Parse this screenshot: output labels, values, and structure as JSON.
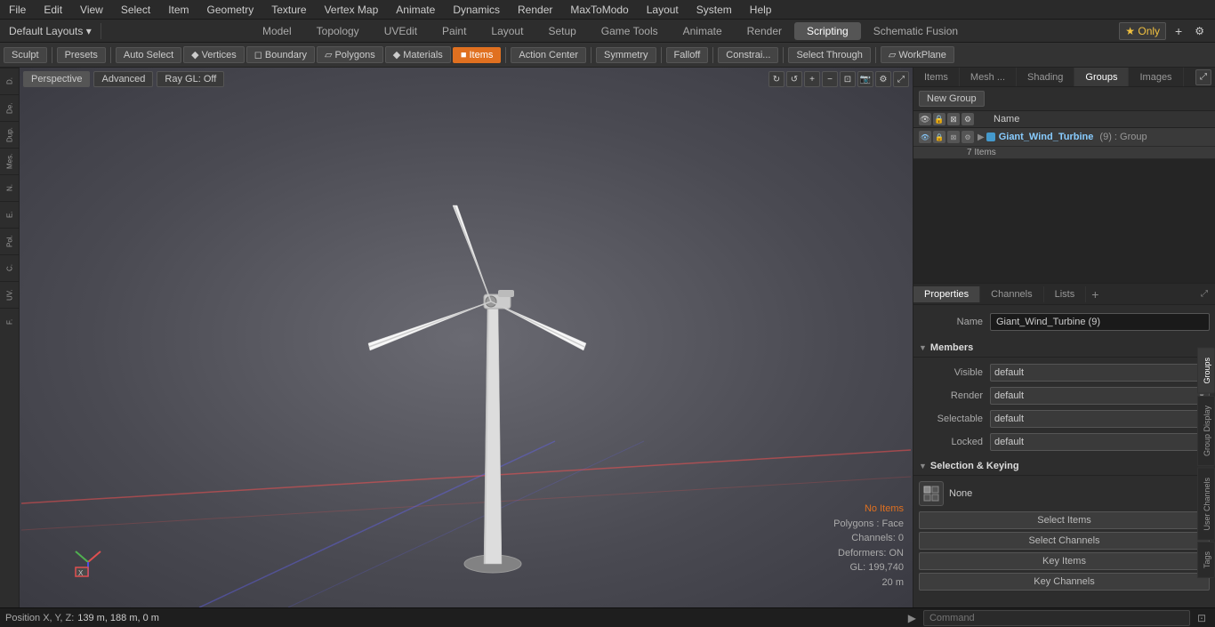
{
  "menu": {
    "items": [
      "File",
      "Edit",
      "View",
      "Select",
      "Item",
      "Geometry",
      "Texture",
      "Vertex Map",
      "Animate",
      "Dynamics",
      "Render",
      "MaxToModo",
      "Layout",
      "System",
      "Help"
    ]
  },
  "layout_bar": {
    "layout_label": "Default Layouts ▾",
    "tabs": [
      "Model",
      "Topology",
      "UVEdit",
      "Paint",
      "Layout",
      "Setup",
      "Game Tools",
      "Animate",
      "Render",
      "Scripting",
      "Schematic Fusion"
    ],
    "active_tab": "Render",
    "only_label": "★ Only",
    "plus_label": "+"
  },
  "toolbar": {
    "sculpt_label": "Sculpt",
    "presets_label": "Presets",
    "auto_select_label": "Auto Select",
    "vertices_label": "Vertices",
    "boundary_label": "Boundary",
    "polygons_label": "Polygons",
    "materials_label": "Materials",
    "items_label": "Items",
    "action_center_label": "Action Center",
    "symmetry_label": "Symmetry",
    "falloff_label": "Falloff",
    "constrain_label": "Constrai...",
    "select_through_label": "Select Through",
    "workplane_label": "WorkPlane"
  },
  "viewport": {
    "mode_label": "Perspective",
    "advanced_label": "Advanced",
    "ray_gl_label": "Ray GL: Off",
    "no_items_label": "No Items",
    "polygons_label": "Polygons : Face",
    "channels_label": "Channels: 0",
    "deformers_label": "Deformers: ON",
    "gl_label": "GL: 199,740",
    "zoom_label": "20 m",
    "position_label": "Position X, Y, Z:",
    "position_value": "139 m, 188 m, 0 m"
  },
  "right_panel": {
    "tabs": [
      "Items",
      "Mesh ...",
      "Shading",
      "Groups",
      "Images"
    ],
    "active_tab": "Groups",
    "expand_btn": "⊞",
    "new_group_label": "New Group",
    "header_icons": [
      "👁",
      "🔒",
      "⊠",
      "⚙"
    ],
    "name_header": "Name",
    "group": {
      "name": "Giant_Wind_Turbine",
      "suffix": "(9) : Group",
      "count": "7 Items",
      "icon_labels": [
        "eye",
        "lock",
        "box",
        "gear"
      ]
    }
  },
  "properties": {
    "tabs": [
      "Properties",
      "Channels",
      "Lists"
    ],
    "active_tab": "Properties",
    "name_label": "Name",
    "name_value": "Giant_Wind_Turbine (9)",
    "members_section": "Members",
    "visible_label": "Visible",
    "visible_value": "default",
    "render_label": "Render",
    "render_value": "default",
    "selectable_label": "Selectable",
    "selectable_value": "default",
    "locked_label": "Locked",
    "locked_value": "default",
    "sel_keying_section": "Selection & Keying",
    "none_label": "None",
    "select_items_label": "Select Items",
    "select_channels_label": "Select Channels",
    "key_items_label": "Key Items",
    "key_channels_label": "Key Channels"
  },
  "side_tabs": [
    "Groups",
    "Group Display",
    "User Channels",
    "Tags"
  ],
  "bottom": {
    "arrow_label": "▶",
    "command_placeholder": "Command"
  }
}
